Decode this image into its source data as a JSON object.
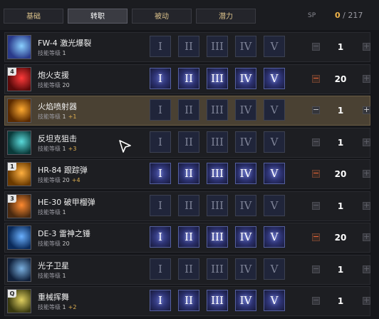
{
  "tabs": [
    "基础",
    "转职",
    "被动",
    "潜力"
  ],
  "active_tab": 1,
  "sp": {
    "label": "SP",
    "current": "0",
    "separator": " / ",
    "total": "217"
  },
  "roman": [
    "I",
    "II",
    "III",
    "IV",
    "V"
  ],
  "level_prefix": "技能等级 ",
  "skills": [
    {
      "name": "FW-4 激光爆裂",
      "level": "1",
      "bonus": "",
      "count": "1",
      "badge": "",
      "runes_lit": false,
      "minus_active": false,
      "selected": false,
      "colors": [
        "#2a3a8a",
        "#8ad0ff"
      ]
    },
    {
      "name": "炮火支援",
      "level": "20",
      "bonus": "",
      "count": "20",
      "badge": "4",
      "runes_lit": true,
      "minus_active": true,
      "selected": false,
      "colors": [
        "#5a0a0a",
        "#ff3a3a"
      ]
    },
    {
      "name": "火焰喷射器",
      "level": "1",
      "bonus": "+1",
      "count": "1",
      "badge": "",
      "runes_lit": false,
      "minus_active": false,
      "selected": true,
      "colors": [
        "#5a2a00",
        "#ffaa30"
      ]
    },
    {
      "name": "反坦克狙击",
      "level": "1",
      "bonus": "+3",
      "count": "1",
      "badge": "",
      "runes_lit": false,
      "minus_active": false,
      "selected": false,
      "colors": [
        "#0a3a3a",
        "#5adada"
      ]
    },
    {
      "name": "HR-84 跟踪弹",
      "level": "20",
      "bonus": "+4",
      "count": "20",
      "badge": "1",
      "runes_lit": true,
      "minus_active": true,
      "selected": false,
      "colors": [
        "#6a3a00",
        "#ffb040"
      ]
    },
    {
      "name": "HE-30 破甲榴弹",
      "level": "1",
      "bonus": "",
      "count": "1",
      "badge": "3",
      "runes_lit": false,
      "minus_active": false,
      "selected": false,
      "colors": [
        "#4a2a10",
        "#ff8a30"
      ]
    },
    {
      "name": "DE-3 雷神之锤",
      "level": "20",
      "bonus": "",
      "count": "20",
      "badge": "",
      "runes_lit": true,
      "minus_active": true,
      "selected": false,
      "colors": [
        "#0a2a5a",
        "#6ab0ff"
      ]
    },
    {
      "name": "光子卫星",
      "level": "1",
      "bonus": "",
      "count": "1",
      "badge": "",
      "runes_lit": false,
      "minus_active": false,
      "selected": false,
      "colors": [
        "#10203a",
        "#7ab0e0"
      ]
    },
    {
      "name": "重械挥舞",
      "level": "1",
      "bonus": "+2",
      "count": "1",
      "badge": "Q",
      "runes_lit": true,
      "minus_active": false,
      "selected": false,
      "colors": [
        "#3a3a10",
        "#e0d060"
      ]
    }
  ]
}
